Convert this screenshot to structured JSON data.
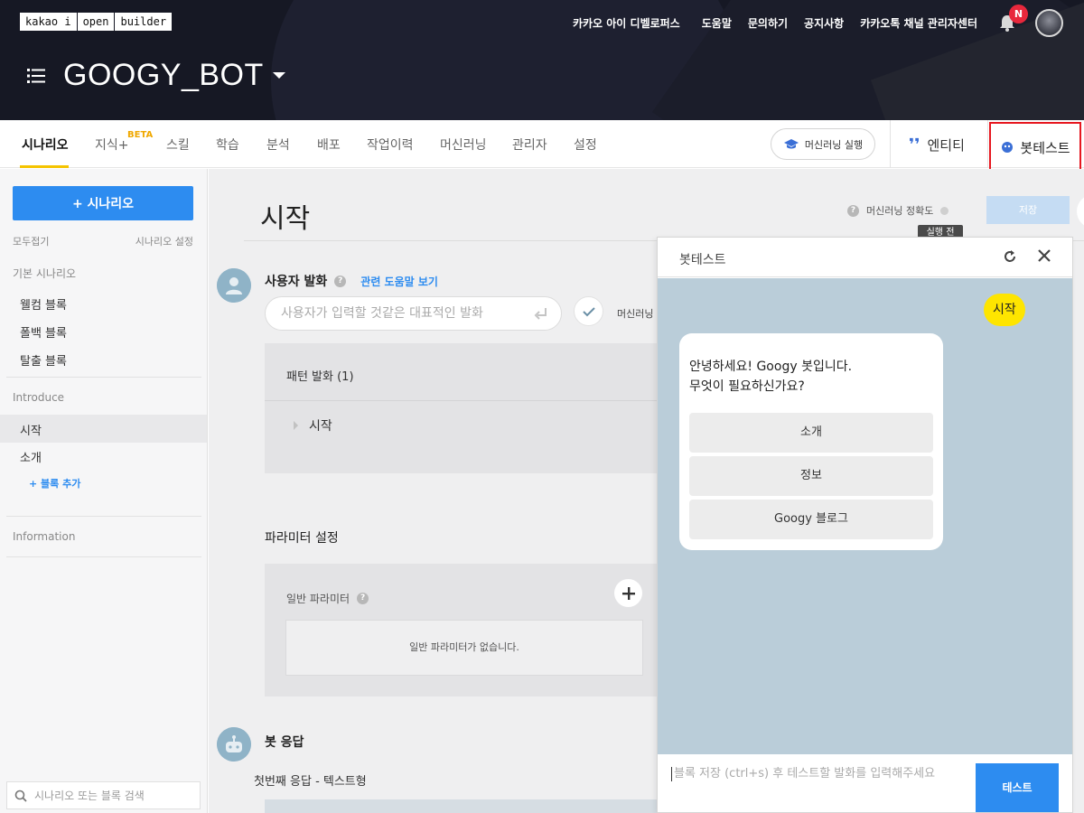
{
  "header": {
    "logo": [
      "kakao i",
      "open",
      "builder"
    ],
    "nav": [
      "카카오 아이 디벨로퍼스",
      "도움말",
      "문의하기",
      "공지사항",
      "카카오톡 채널 관리자센터"
    ],
    "notification_badge": "N",
    "bot_name": "GOOGY_BOT"
  },
  "tabs": {
    "items": [
      "시나리오",
      "지식+",
      "스킬",
      "학습",
      "분석",
      "배포",
      "작업이력",
      "머신러닝",
      "관리자",
      "설정"
    ],
    "beta": "BETA",
    "ml_run": "머신러닝 실행",
    "entity": "엔티티",
    "bot_test": "봇테스트"
  },
  "sidebar": {
    "add_scenario": "+ 시나리오",
    "collapse_all": "모두접기",
    "scenario_settings": "시나리오 설정",
    "basic_section": "기본 시나리오",
    "basic_items": [
      "웰컴 블록",
      "폴백 블록",
      "탈출 블록"
    ],
    "introduce_section": "Introduce",
    "introduce_items": [
      "시작",
      "소개"
    ],
    "add_block": "+ 블록 추가",
    "information_section": "Information",
    "search_placeholder": "시나리오 또는 블록 검색"
  },
  "main": {
    "title": "시작",
    "ml_accuracy": "머신러닝 정확도",
    "tooltip": "실행 전",
    "save": "저장",
    "user_utterance": "사용자 발화",
    "help_link": "관련 도움말 보기",
    "utterance_placeholder": "사용자가 입력할 것같은 대표적인 발화",
    "ml_label": "머신러닝",
    "pattern_title": "패턴 발화 (1)",
    "pattern_items": [
      "시작"
    ],
    "param_settings": "파라미터 설정",
    "general_params": "일반 파라미터",
    "no_params": "일반 파라미터가 없습니다.",
    "bot_response": "봇 응답",
    "first_response": "첫번째 응답 - 텍스트형"
  },
  "bottest": {
    "title": "봇테스트",
    "user_message": "시작",
    "bot_message": "안녕하세요! Googy 봇입니다.\n무엇이 필요하신가요?",
    "quick_replies": [
      "소개",
      "정보",
      "Googy 블로그"
    ],
    "input_placeholder": "블록 저장 (ctrl+s) 후 테스트할 발화를 입력해주세요",
    "test_button": "테스트"
  },
  "colors": {
    "accent_blue": "#2d8cf0",
    "header_bg": "#161824",
    "tab_underline": "#f5c400",
    "highlight_border": "#e6171f",
    "user_bubble": "#fee500",
    "chat_bg": "#bacdd9"
  }
}
